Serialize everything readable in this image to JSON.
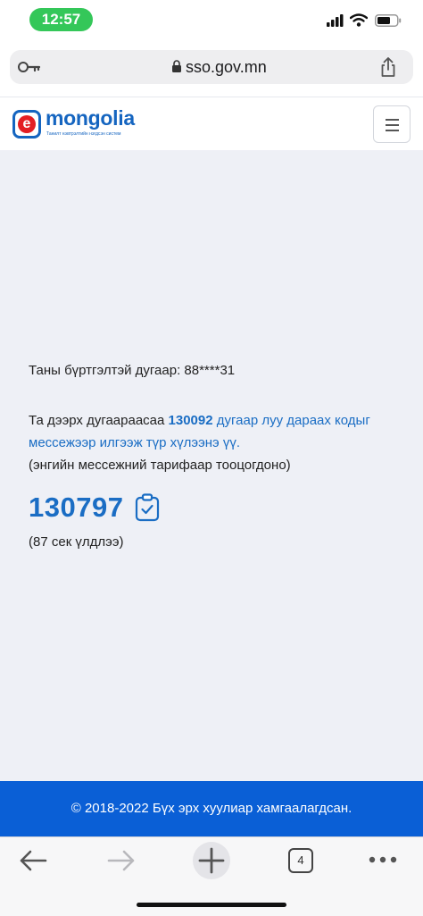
{
  "status_bar": {
    "time": "12:57"
  },
  "browser": {
    "url": "sso.gov.mn",
    "tab_count": "4"
  },
  "site": {
    "logo_letter": "e",
    "logo_name": "mongolia",
    "logo_tagline": "Танилт нэвтрэлтийн нэгдсэн систем"
  },
  "verification": {
    "registered_number": "Таны бүртгэлтэй дугаар: 88****31",
    "instruction_prefix": "Та дээрх дугаараасаа ",
    "target_number": "130092",
    "instruction_link": " дугаар луу дараах кодыг мессежээр илгээж түр хүлээнэ үү.",
    "tariff_note": "(энгийн мессежний тарифаар тооцогдоно)",
    "code": "130797",
    "countdown": "(87 сек үлдлээ)"
  },
  "footer": {
    "copyright": "© 2018-2022 Бүх эрх хуулиар хамгаалагдсан."
  },
  "colors": {
    "accent": "#1a6dc4",
    "footer_bg": "#0a5fd6",
    "status_pill": "#34c759",
    "logo_red": "#e31e24"
  }
}
